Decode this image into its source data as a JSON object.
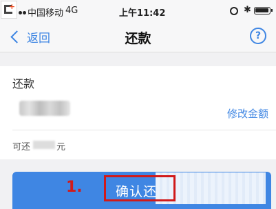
{
  "status_bar": {
    "carrier": "中国移动",
    "network": "4G",
    "time": "上午11:42"
  },
  "nav": {
    "back_label": "返回",
    "title": "还款",
    "help_symbol": "?"
  },
  "card": {
    "section_label": "还款",
    "modify_amount_label": "修改金额",
    "available_prefix": "可还",
    "available_suffix": "元"
  },
  "confirm_button": {
    "label": "确认还"
  },
  "annotation": {
    "step_label": "1."
  },
  "colors": {
    "accent": "#3f86e3",
    "highlight": "#d11a1a"
  }
}
